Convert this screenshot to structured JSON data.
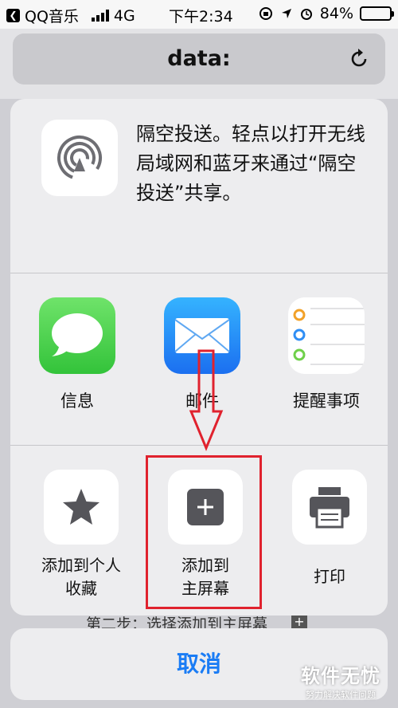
{
  "status_bar": {
    "carrier": "QQ音乐",
    "network": "4G",
    "time": "下午2:34",
    "battery": "84%",
    "battery_level": 0.84
  },
  "browser": {
    "address": "data:"
  },
  "behind_page": {
    "text": "第二步：选择添加到主屏幕",
    "plus": "+"
  },
  "share_sheet": {
    "airdrop_text": "隔空投送。轻点以打开无线局域网和蓝牙来通过“隔空投送”共享。",
    "apps": [
      {
        "label": "信息",
        "icon": "messages-icon"
      },
      {
        "label": "邮件",
        "icon": "mail-icon"
      },
      {
        "label": "提醒事项",
        "icon": "reminders-icon"
      }
    ],
    "actions": [
      {
        "label_line1": "添加到个人",
        "label_line2": "收藏",
        "icon": "star-icon"
      },
      {
        "label_line1": "添加到",
        "label_line2": "主屏幕",
        "icon": "add-square-icon"
      },
      {
        "label_line1": "打印",
        "label_line2": "",
        "icon": "printer-icon"
      }
    ],
    "cancel": "取消"
  },
  "colors": {
    "accent": "#1a7cf5",
    "annotation_red": "#e0222e"
  },
  "watermark": {
    "main": "软件无忧",
    "sub": "努力解决软件问题"
  }
}
